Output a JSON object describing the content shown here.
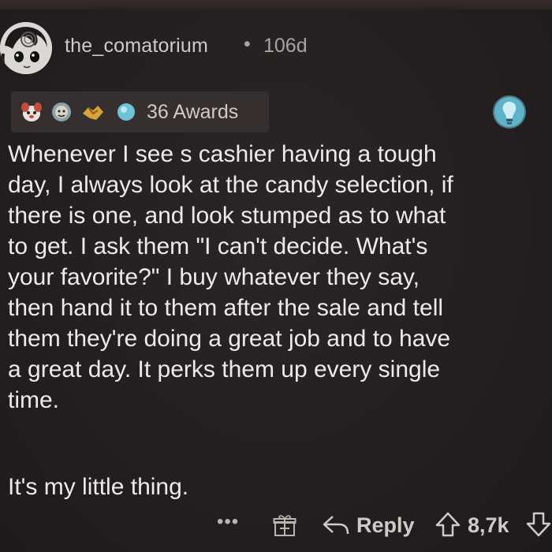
{
  "post": {
    "username": "the_comatorium",
    "separator": "•",
    "age": "106d",
    "awards_label": "36 Awards",
    "body": "Whenever I see s cashier having a tough\nday, I always look at the candy selection, if\nthere is one, and look stumped as to what\nto get. I ask them \"I can't decide. What's\nyour favorite?\" I buy whatever they say,\nthen hand it to them after the sale and tell\nthem they're doing a great job and to have\na great day. It perks them up every single\ntime.",
    "body_tail": "It's my little thing."
  },
  "actions": {
    "more": "•••",
    "reply": "Reply",
    "votes": "8,7k"
  },
  "icons": {
    "avatar": "avatar-icon",
    "award1": "dog-award-icon",
    "award2": "hug-award-icon",
    "award3": "handshake-award-icon",
    "award4": "gem-award-icon",
    "bulb": "lightbulb-icon",
    "gift": "gift-icon",
    "reply": "reply-arrow-icon",
    "up": "upvote-icon",
    "down": "downvote-icon"
  },
  "colors": {
    "background": "#231f20",
    "text": "#ecebea",
    "muted": "#a9a4a2",
    "award_bg": "#35302f",
    "bulb": "#5fb3c8"
  }
}
